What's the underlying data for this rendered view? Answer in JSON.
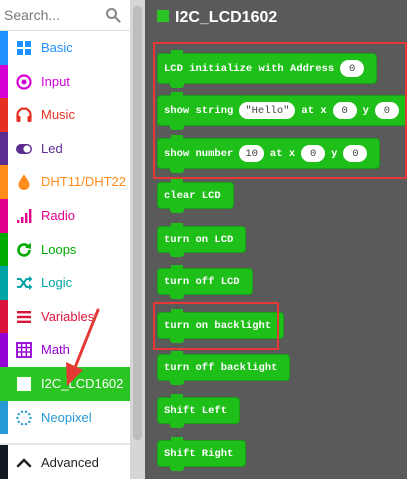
{
  "search": {
    "placeholder": "Search..."
  },
  "categories": [
    {
      "label": "Basic",
      "color": "#1e90ff",
      "icon": "grid-icon"
    },
    {
      "label": "Input",
      "color": "#d400d4",
      "icon": "target-icon"
    },
    {
      "label": "Music",
      "color": "#e63022",
      "icon": "headphones-icon"
    },
    {
      "label": "Led",
      "color": "#5c2d91",
      "icon": "toggle-icon"
    },
    {
      "label": "DHT11/DHT22",
      "color": "#ff8c1a",
      "icon": "drop-icon"
    },
    {
      "label": "Radio",
      "color": "#e3008c",
      "icon": "signal-bars-icon"
    },
    {
      "label": "Loops",
      "color": "#00aa00",
      "icon": "refresh-icon"
    },
    {
      "label": "Logic",
      "color": "#00a4a6",
      "icon": "shuffle-icon"
    },
    {
      "label": "Variables",
      "color": "#dc143c",
      "icon": "list-lines-icon"
    },
    {
      "label": "Math",
      "color": "#9400d3",
      "icon": "calculator-icon"
    },
    {
      "label": "I2C_LCD1602",
      "color": "#2bc523",
      "icon": "square-icon",
      "selected": true
    },
    {
      "label": "Neopixel",
      "color": "#2699d6",
      "icon": "dotted-circle-icon"
    }
  ],
  "advanced": {
    "label": "Advanced",
    "icon": "chevron-up-icon"
  },
  "flyout": {
    "title": "I2C_LCD1602",
    "accent": "#2bc523",
    "blocks": [
      {
        "name": "lcd-initialize-block",
        "parts": [
          {
            "t": "LCD initialize with Address"
          },
          {
            "p": "0"
          }
        ]
      },
      {
        "name": "show-string-block",
        "parts": [
          {
            "t": "show string"
          },
          {
            "p": "\"Hello\""
          },
          {
            "t": "at x"
          },
          {
            "p": "0"
          },
          {
            "t": "y"
          },
          {
            "p": "0"
          }
        ]
      },
      {
        "name": "show-number-block",
        "parts": [
          {
            "t": "show number"
          },
          {
            "p": "10"
          },
          {
            "t": "at x"
          },
          {
            "p": "0"
          },
          {
            "t": "y"
          },
          {
            "p": "0"
          }
        ]
      },
      {
        "name": "clear-lcd-block",
        "parts": [
          {
            "t": "clear LCD"
          }
        ]
      },
      {
        "name": "turn-on-lcd-block",
        "parts": [
          {
            "t": "turn on LCD"
          }
        ]
      },
      {
        "name": "turn-off-lcd-block",
        "parts": [
          {
            "t": "turn off LCD"
          }
        ]
      },
      {
        "name": "turn-on-backlight-block",
        "parts": [
          {
            "t": "turn on backlight"
          }
        ]
      },
      {
        "name": "turn-off-backlight-block",
        "parts": [
          {
            "t": "turn off backlight"
          }
        ]
      },
      {
        "name": "shift-left-block",
        "parts": [
          {
            "t": "Shift Left"
          }
        ]
      },
      {
        "name": "shift-right-block",
        "parts": [
          {
            "t": "Shift Right"
          }
        ]
      }
    ]
  },
  "highlight_color": "#e53935"
}
